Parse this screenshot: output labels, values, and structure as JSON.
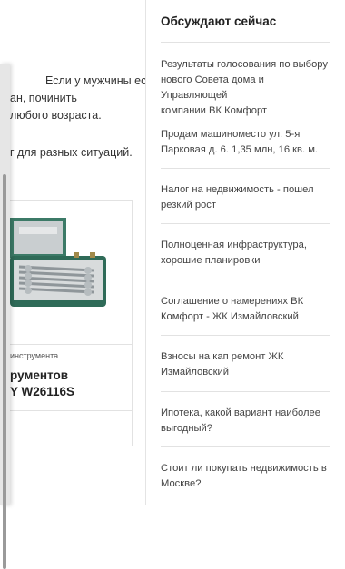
{
  "article": {
    "lines": [
      "Если у мужчины есть",
      "ан, починить",
      "любого возраста.",
      "г для разных ситуаций."
    ]
  },
  "product": {
    "category": "инструмента",
    "title_line1": "рументов",
    "title_line2": "Y W26116S",
    "image_icon": "wrench-set-case-icon"
  },
  "sidebar": {
    "title": "Обсуждают сейчас",
    "items": [
      {
        "line1": "Результаты голосования по выбору",
        "line2": "нового Совета дома и Управляющей",
        "line3": "компании ВК Комфорт"
      },
      {
        "line1": "Продам машиноместо ул. 5-я",
        "line2": "Парковая д. 6. 1,35 млн, 16 кв. м.",
        "line3": ""
      },
      {
        "line1": "Налог на недвижимость - пошел",
        "line2": "резкий рост",
        "line3": ""
      },
      {
        "line1": "Полноценная инфраструктура,",
        "line2": "хорошие планировки",
        "line3": ""
      },
      {
        "line1": "Соглашение о намерениях ВК",
        "line2": "Комфорт - ЖК Измайловский",
        "line3": ""
      },
      {
        "line1": "Взносы на кап ремонт ЖК",
        "line2": "Измайловский",
        "line3": ""
      },
      {
        "line1": "Ипотека, какой вариант наиболее",
        "line2": "выгодный?",
        "line3": ""
      },
      {
        "line1": "Стоит ли покупать недвижимость в",
        "line2": "Москве?",
        "line3": ""
      }
    ]
  },
  "colors": {
    "text": "#333333",
    "divider": "#e2e2e2",
    "case_green": "#2f6b58"
  }
}
